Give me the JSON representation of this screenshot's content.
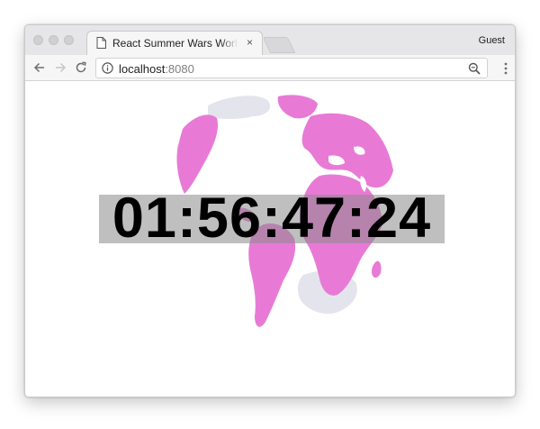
{
  "tab": {
    "title": "React Summer Wars World Clock",
    "close_glyph": "×",
    "icon": "page-icon"
  },
  "profile": {
    "label": "Guest"
  },
  "toolbar": {
    "back_icon": "back-arrow-icon",
    "forward_icon": "forward-arrow-icon",
    "reload_icon": "reload-icon",
    "menu_icon": "vertical-dots-icon"
  },
  "address": {
    "host": "localhost",
    "port": ":8080",
    "info_icon": "info-circle-icon",
    "zoom_icon": "magnifier-icon"
  },
  "clock": {
    "time": "01:56:47:24"
  },
  "colors": {
    "land": "#e87ad6",
    "land_back": "#e6e6ee",
    "clock_background": "#8a8a8a"
  }
}
